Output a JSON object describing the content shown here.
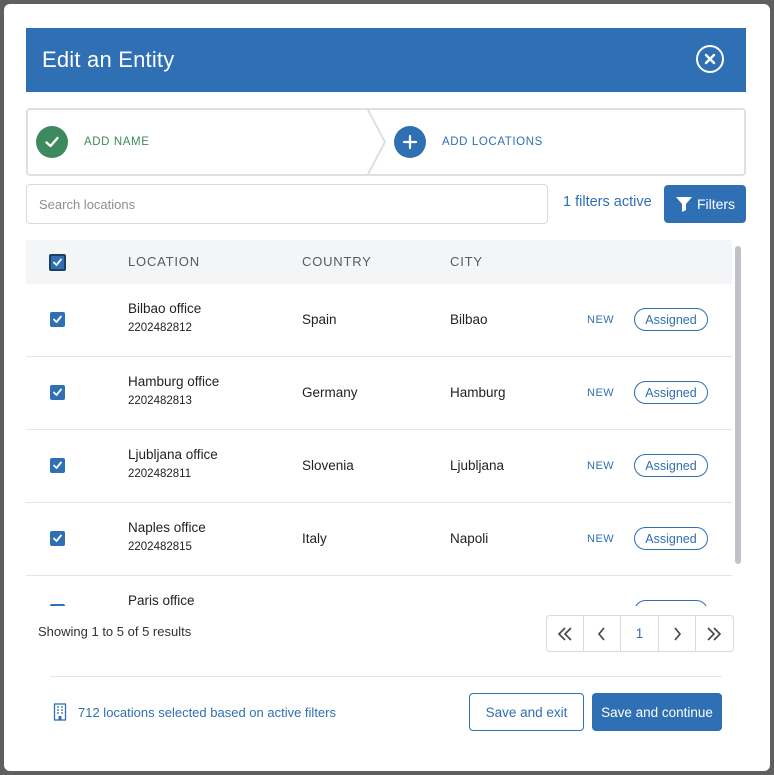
{
  "modal": {
    "title": "Edit an Entity"
  },
  "stepper": {
    "steps": [
      {
        "label": "ADD NAME",
        "state": "done",
        "icon": "check-icon"
      },
      {
        "label": "ADD LOCATIONS",
        "state": "active",
        "icon": "plus-icon"
      }
    ]
  },
  "search": {
    "placeholder": "Search locations",
    "value": ""
  },
  "filters": {
    "active_text": "1 filters active",
    "button_label": "Filters"
  },
  "table": {
    "columns": [
      "LOCATION",
      "COUNTRY",
      "CITY"
    ],
    "rows": [
      {
        "name": "Bilbao office",
        "id": "2202482812",
        "country": "Spain",
        "city": "Bilbao",
        "tag": "NEW",
        "status": "Assigned"
      },
      {
        "name": "Hamburg office",
        "id": "2202482813",
        "country": "Germany",
        "city": "Hamburg",
        "tag": "NEW",
        "status": "Assigned"
      },
      {
        "name": "Ljubljana office",
        "id": "2202482811",
        "country": "Slovenia",
        "city": "Ljubljana",
        "tag": "NEW",
        "status": "Assigned"
      },
      {
        "name": "Naples office",
        "id": "2202482815",
        "country": "Italy",
        "city": "Napoli",
        "tag": "NEW",
        "status": "Assigned"
      },
      {
        "name": "Paris office",
        "id": "",
        "country": "",
        "city": "",
        "tag": "",
        "status": ""
      }
    ]
  },
  "pagination": {
    "showing": "Showing 1 to 5 of 5 results",
    "current_page": "1",
    "first": "«",
    "prev": "‹",
    "next": "›",
    "last": "»"
  },
  "footer": {
    "selected_text": "712 locations selected based on active filters",
    "save_exit_label": "Save and exit",
    "save_continue_label": "Save and continue"
  },
  "colors": {
    "primary": "#2f6fb3",
    "success": "#3c8a5d"
  }
}
